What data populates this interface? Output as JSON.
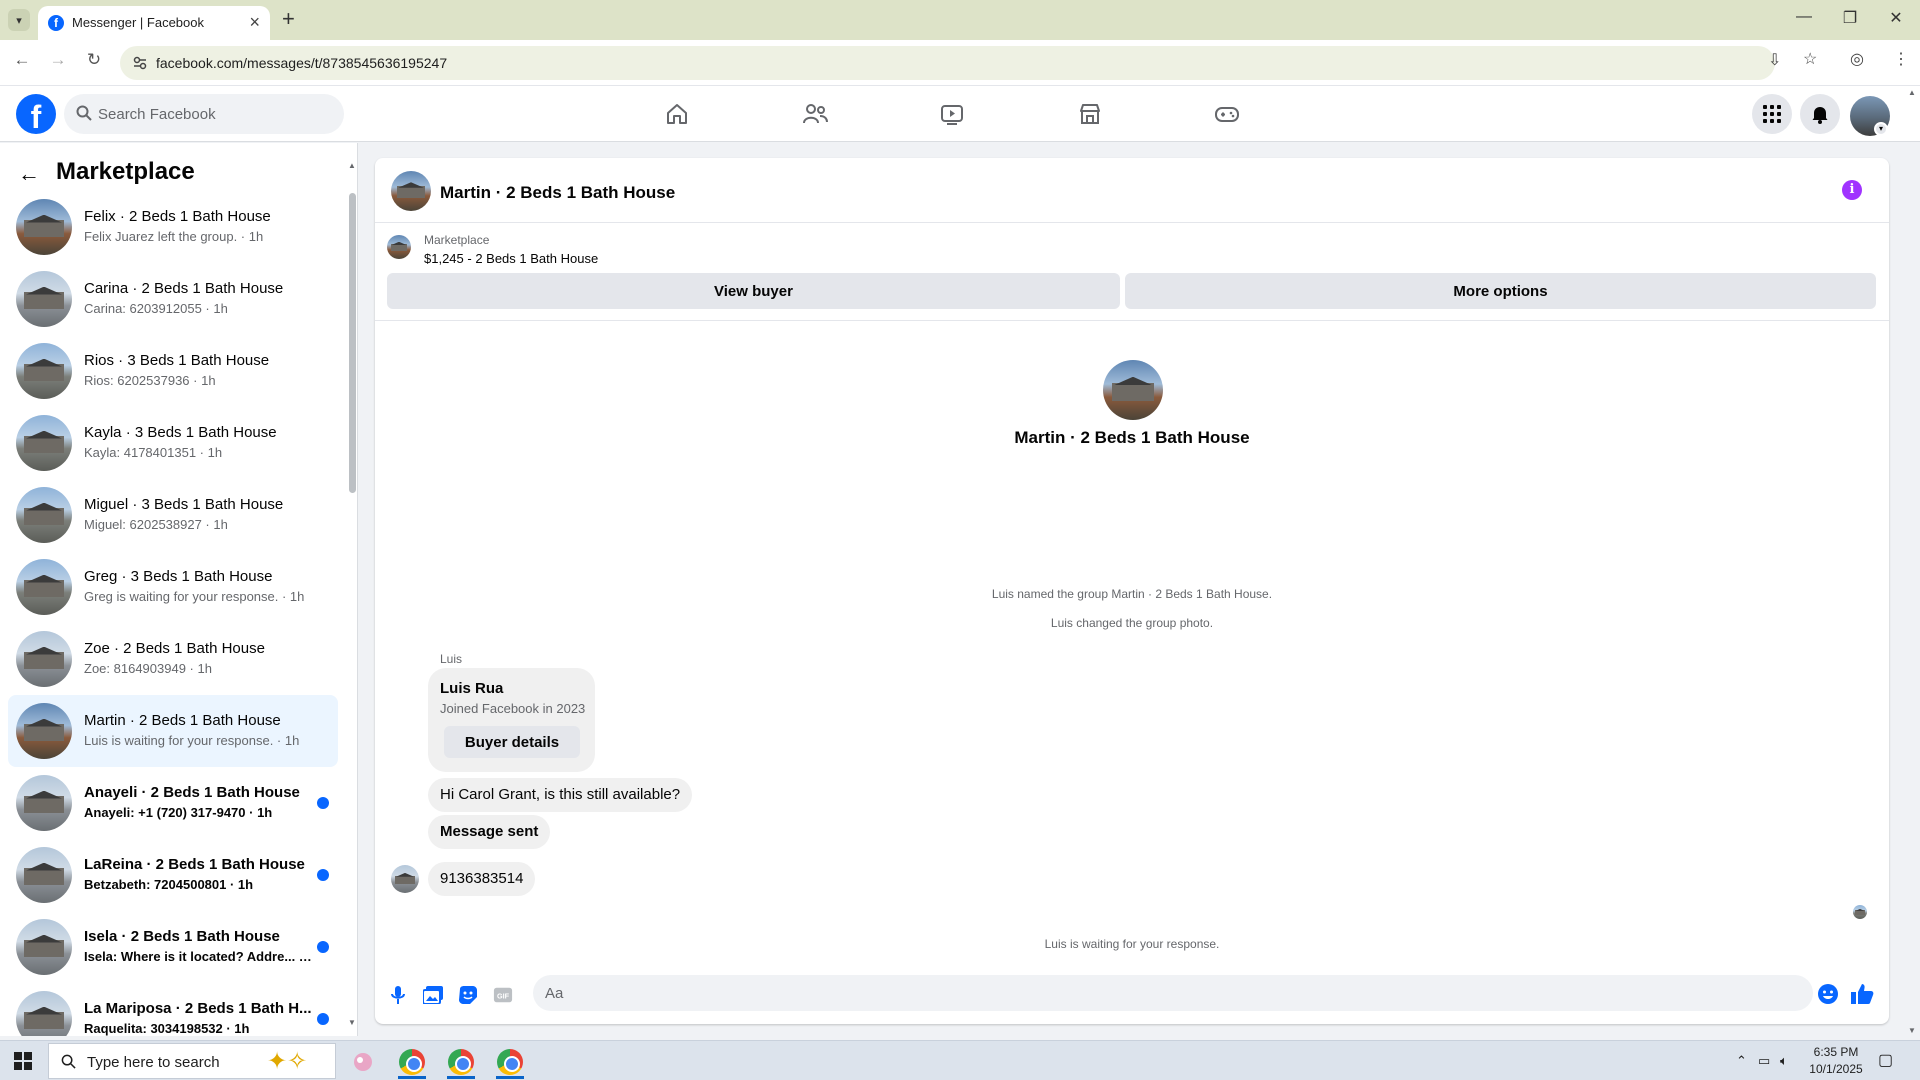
{
  "browser": {
    "tab_title": "Messenger | Facebook",
    "url": "facebook.com/messages/t/8738545636195247"
  },
  "header": {
    "search_placeholder": "Search Facebook",
    "nav_icons": [
      "home-icon",
      "friends-icon",
      "video-icon",
      "marketplace-icon",
      "gaming-icon"
    ],
    "right_icons": [
      "menu-grid-icon",
      "bell-icon",
      "profile-avatar"
    ],
    "brand_color": "#0866ff"
  },
  "sidebar": {
    "title": "Marketplace",
    "conversations": [
      {
        "title": "Felix · 2 Beds 1 Bath House",
        "subtitle": "Felix Juarez left the group. · 1h",
        "unread": false,
        "active": false
      },
      {
        "title": "Carina · 2 Beds 1 Bath House",
        "subtitle": "Carina: 6203912055 · 1h",
        "unread": false,
        "active": false
      },
      {
        "title": "Rios · 3 Beds 1 Bath House",
        "subtitle": "Rios: 6202537936 · 1h",
        "unread": false,
        "active": false
      },
      {
        "title": "Kayla · 3 Beds 1 Bath House",
        "subtitle": "Kayla: 4178401351 · 1h",
        "unread": false,
        "active": false
      },
      {
        "title": "Miguel · 3 Beds 1 Bath House",
        "subtitle": "Miguel: 6202538927 · 1h",
        "unread": false,
        "active": false
      },
      {
        "title": "Greg · 3 Beds 1 Bath House",
        "subtitle": "Greg is waiting for your response. · 1h",
        "unread": false,
        "active": false
      },
      {
        "title": "Zoe · 2 Beds 1 Bath House",
        "subtitle": "Zoe: 8164903949 · 1h",
        "unread": false,
        "active": false
      },
      {
        "title": "Martin · 2 Beds 1 Bath House",
        "subtitle": "Luis is waiting for your response. · 1h",
        "unread": false,
        "active": true
      },
      {
        "title": "Anayeli · 2 Beds 1 Bath House",
        "subtitle": "Anayeli: +1 (720) 317-9470 · 1h",
        "unread": true,
        "active": false
      },
      {
        "title": "LaReina · 2 Beds 1 Bath House",
        "subtitle": "Betzabeth: 7204500801 · 1h",
        "unread": true,
        "active": false
      },
      {
        "title": "Isela · 2 Beds 1 Bath House",
        "subtitle": "Isela: Where is it located? Addre... · 1h",
        "unread": true,
        "active": false
      },
      {
        "title": "La Mariposa · 2 Beds 1 Bath H...",
        "subtitle": "Raquelita: 3034198532 · 1h",
        "unread": true,
        "active": false
      }
    ]
  },
  "chat": {
    "title": "Martin · 2 Beds 1 Bath House",
    "marketplace_label": "Marketplace",
    "listing": "$1,245 - 2 Beds 1 Bath House",
    "view_buyer": "View buyer",
    "more_options": "More options",
    "intro_title": "Martin · 2 Beds 1 Bath House",
    "system_messages": [
      "Luis named the group Martin · 2 Beds 1 Bath House.",
      "Luis changed the group photo."
    ],
    "sender_name": "Luis",
    "card": {
      "name": "Luis Rua",
      "joined": "Joined Facebook in 2023",
      "button": "Buyer details"
    },
    "messages": [
      "Hi Carol Grant, is this still available?",
      "Message sent",
      "9136383514"
    ],
    "waiting_note": "Luis is waiting for your response.",
    "composer_placeholder": "Aa",
    "accent_color": "#0866ff",
    "info_color": "#a033ff"
  },
  "taskbar": {
    "search_placeholder": "Type here to search",
    "time": "6:35 PM",
    "date": "10/1/2025"
  }
}
